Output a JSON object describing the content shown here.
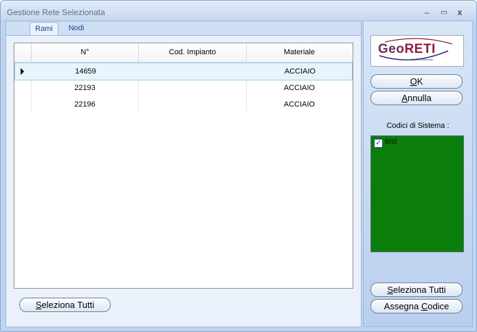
{
  "window": {
    "title": "Gestione Rete Selezionata"
  },
  "titlebar_buttons": {
    "minimize": "–",
    "maximize": "▭",
    "close": "x"
  },
  "tabs": [
    {
      "label": "Rami",
      "active": true
    },
    {
      "label": "Nodi",
      "active": false
    }
  ],
  "grid": {
    "columns": [
      "N°",
      "Cod. Impianto",
      "Materiale"
    ],
    "rows": [
      {
        "n": "14659",
        "cod": "",
        "materiale": "ACCIAIO",
        "selected": true
      },
      {
        "n": "22193",
        "cod": "",
        "materiale": "ACCIAIO",
        "selected": false
      },
      {
        "n": "22196",
        "cod": "",
        "materiale": "ACCIAIO",
        "selected": false
      }
    ]
  },
  "left_buttons": {
    "seleziona_tutti": {
      "mnemonic": "S",
      "rest": "eleziona Tutti"
    }
  },
  "logo": {
    "text_geo": "Geo",
    "text_reti": "RETI",
    "tagline": "Servizi Ambientali"
  },
  "right_buttons": {
    "ok": {
      "mnemonic": "O",
      "rest": "K"
    },
    "annulla": {
      "mnemonic": "A",
      "rest": "nnulla"
    },
    "seleziona_tutti": {
      "mnemonic": "S",
      "rest": "eleziona Tutti"
    },
    "assegna_codice": {
      "pre": "Assegna ",
      "mnemonic": "C",
      "rest": "odice"
    }
  },
  "codici": {
    "label": "Codici di Sistema :",
    "items": [
      {
        "label": "test",
        "checked": true
      }
    ],
    "list_color": "#0a7d0a"
  },
  "colors": {
    "accent": "#15428b",
    "frame": "#bfd4ef"
  }
}
